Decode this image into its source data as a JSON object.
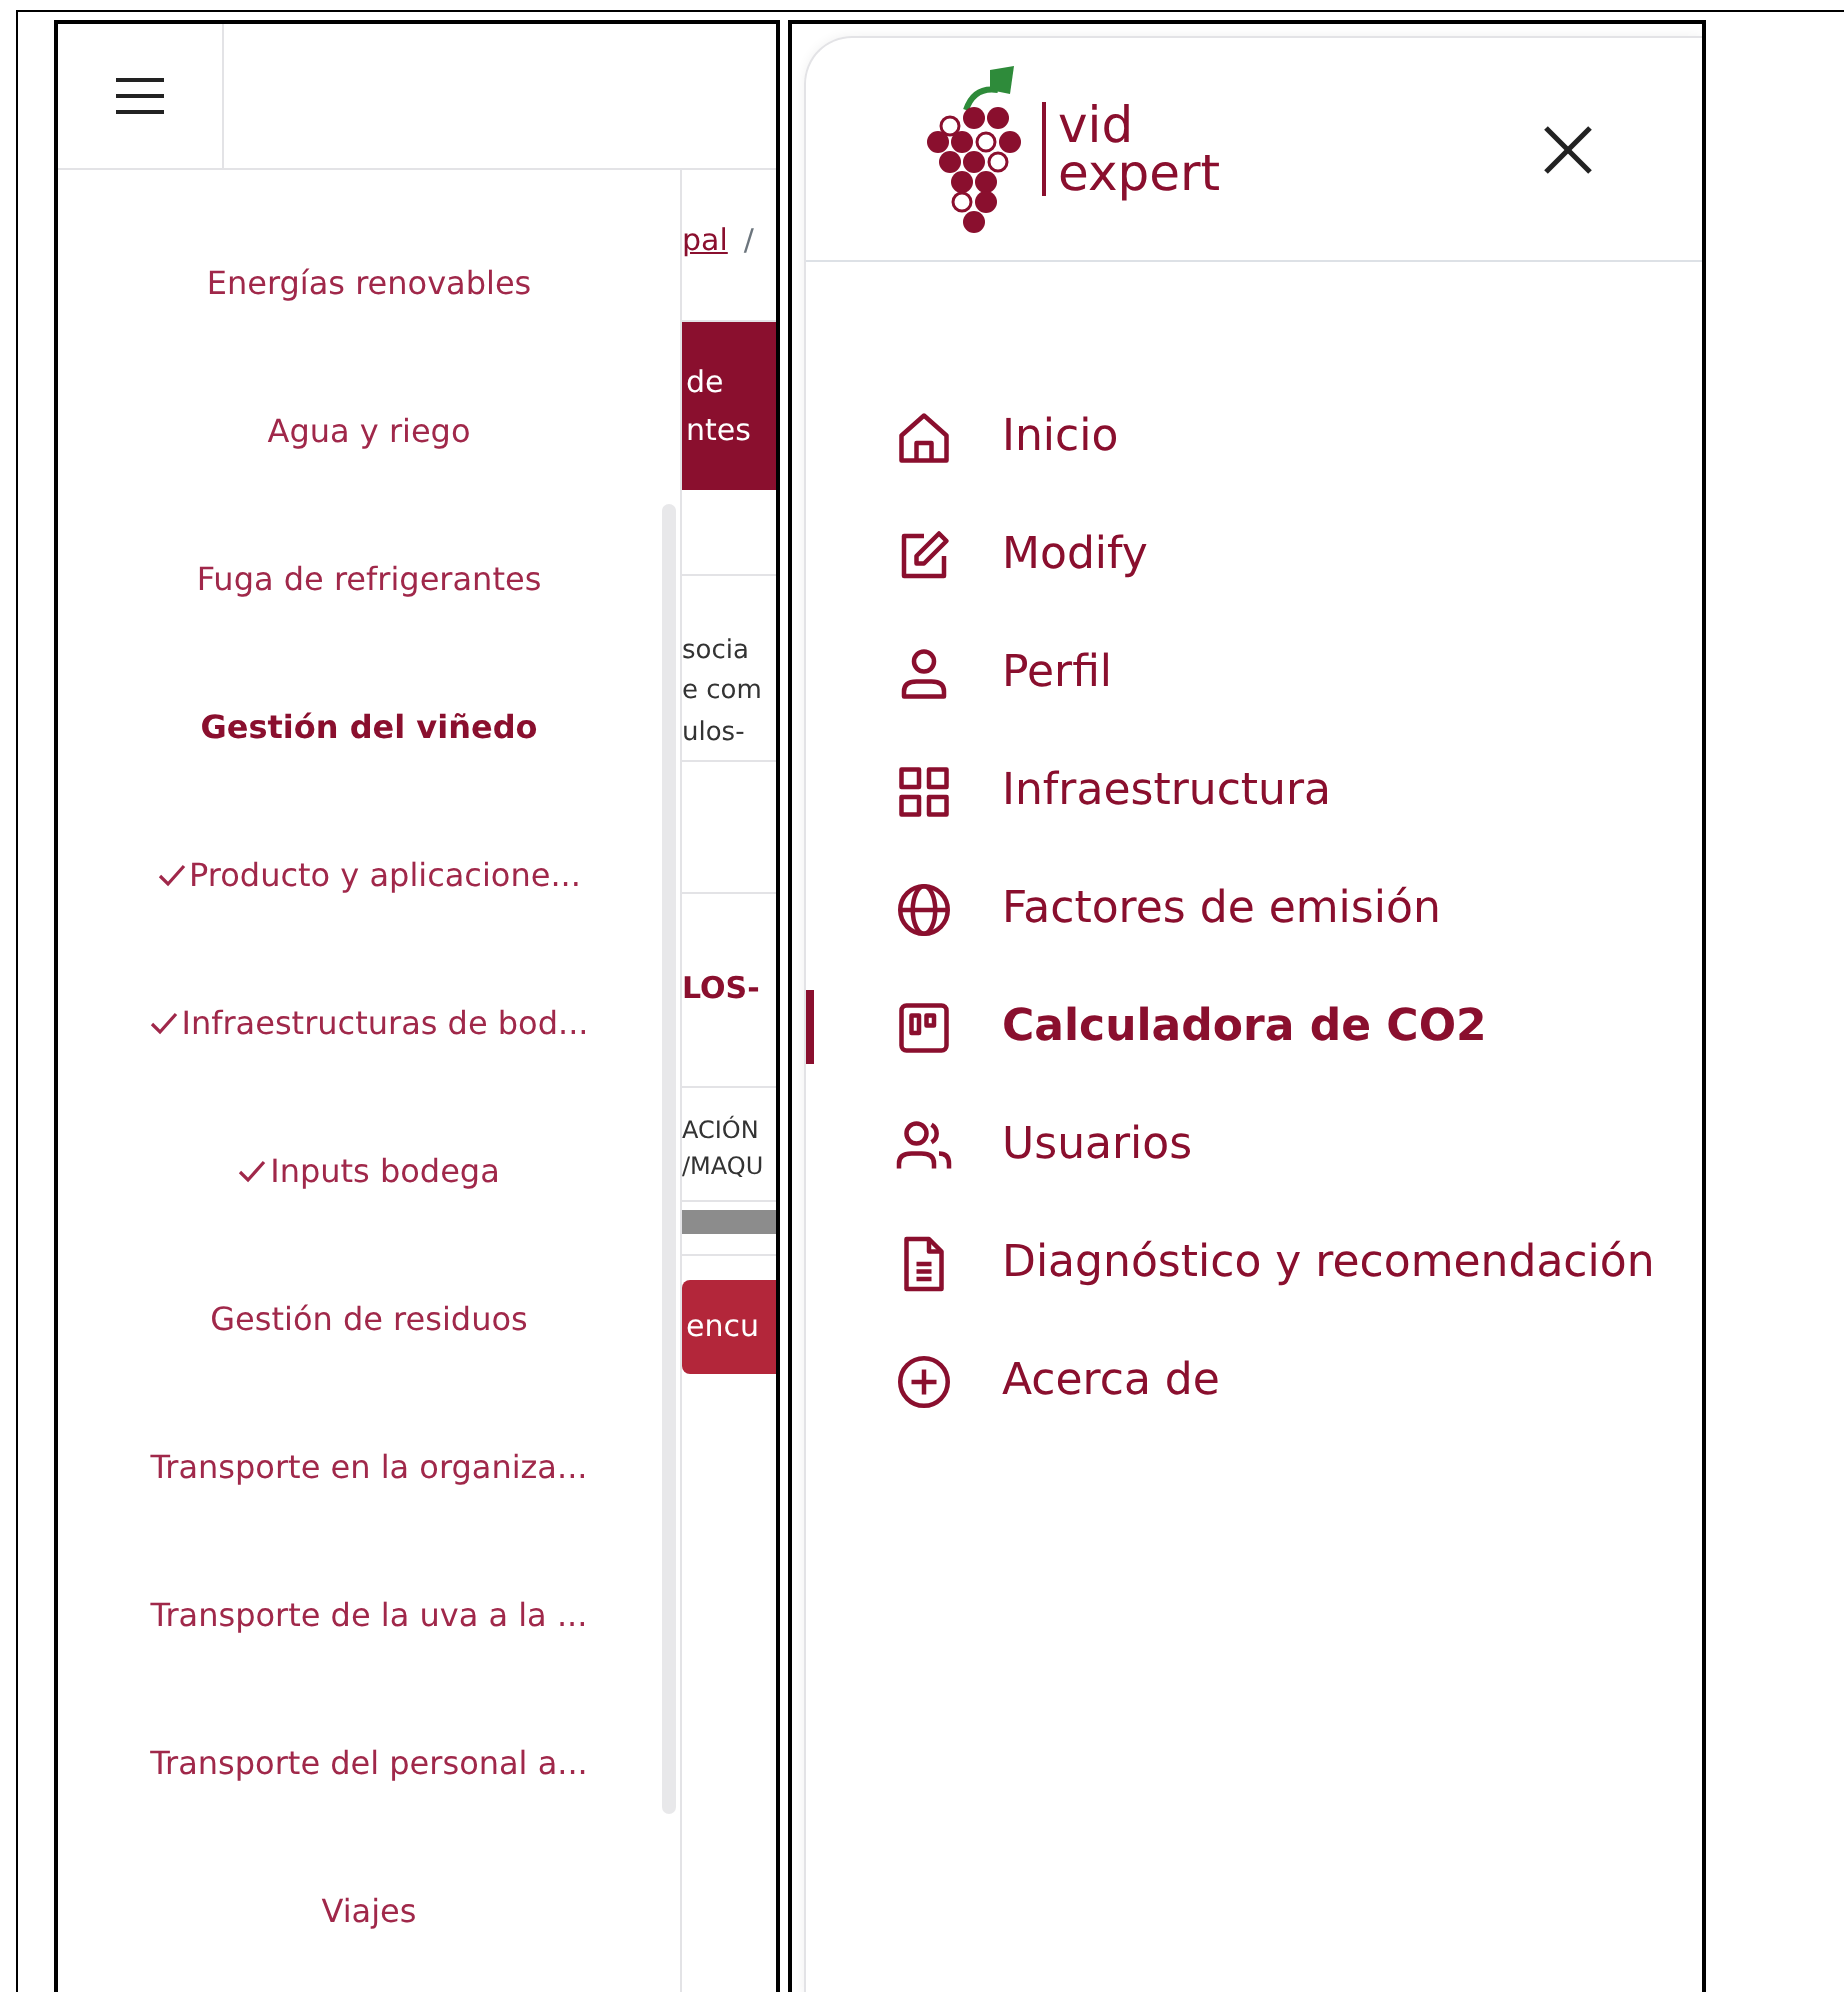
{
  "left_screen": {
    "menu_items": [
      {
        "label": "Energías renovables",
        "selected": false,
        "checked": false
      },
      {
        "label": "Agua y riego",
        "selected": false,
        "checked": false
      },
      {
        "label": "Fuga de refrigerantes",
        "selected": false,
        "checked": false
      },
      {
        "label": "Gestión del viñedo",
        "selected": true,
        "checked": false
      },
      {
        "label": "Producto y aplicacione...",
        "selected": false,
        "checked": true
      },
      {
        "label": "Infraestructuras de bod...",
        "selected": false,
        "checked": true
      },
      {
        "label": "Inputs bodega",
        "selected": false,
        "checked": true
      },
      {
        "label": "Gestión de residuos",
        "selected": false,
        "checked": false
      },
      {
        "label": "Transporte en la organiza...",
        "selected": false,
        "checked": false
      },
      {
        "label": "Transporte de la uva a la ...",
        "selected": false,
        "checked": false
      },
      {
        "label": "Transporte del personal a...",
        "selected": false,
        "checked": false
      },
      {
        "label": "Viajes",
        "selected": false,
        "checked": false
      }
    ],
    "background_page": {
      "breadcrumb_link": "pal",
      "breadcrumb_separator": "/",
      "banner_lines": [
        "de",
        "ntes"
      ],
      "text_lines": [
        "socia",
        "e com",
        "ulos-"
      ],
      "heading": "LOS-",
      "table_header_lines": [
        "ACIÓN",
        "/MAQU"
      ],
      "button": "encu"
    }
  },
  "right_screen": {
    "logo": {
      "line_1": "vid",
      "line_2": "expert"
    },
    "nav_items": [
      {
        "label": "Inicio",
        "kind": "home",
        "selected": false
      },
      {
        "label": "Modify",
        "kind": "edit",
        "selected": false
      },
      {
        "label": "Perfil",
        "kind": "person",
        "selected": false
      },
      {
        "label": "Infraestructura",
        "kind": "grid",
        "selected": false
      },
      {
        "label": "Factores de emisión",
        "kind": "globe",
        "selected": false
      },
      {
        "label": "Calculadora de CO2",
        "kind": "calculator",
        "selected": true
      },
      {
        "label": "Usuarios",
        "kind": "people",
        "selected": false
      },
      {
        "label": "Diagnóstico y recomendación",
        "kind": "document",
        "selected": false
      },
      {
        "label": "Acerca de",
        "kind": "plus",
        "selected": false
      }
    ]
  }
}
